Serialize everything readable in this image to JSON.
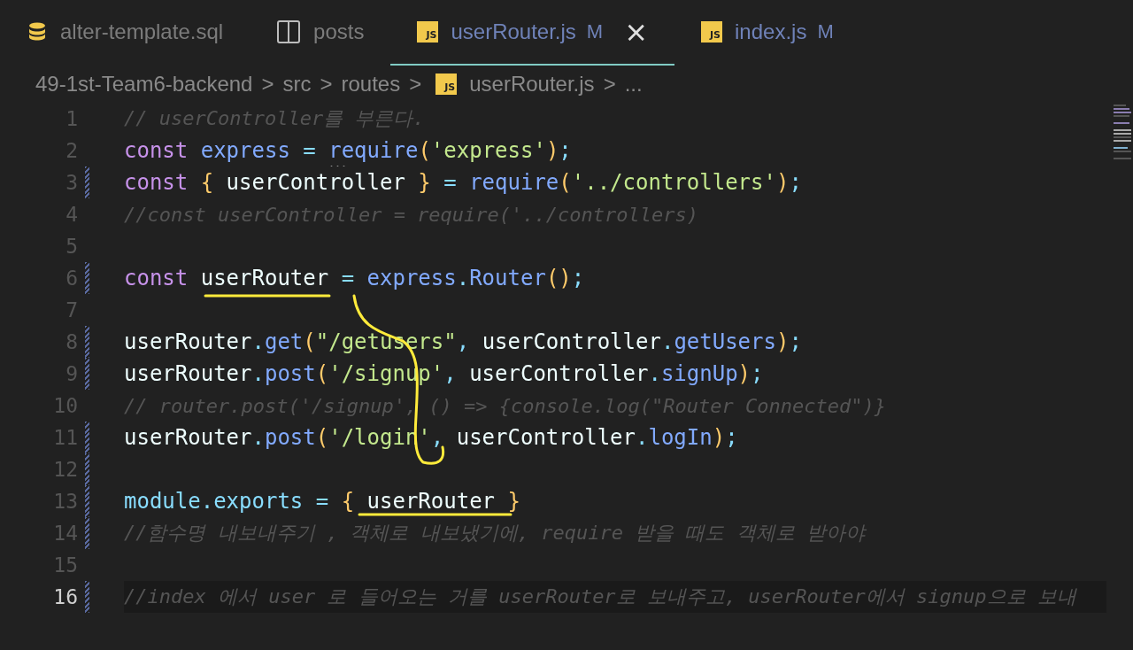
{
  "tabs": [
    {
      "kind": "database",
      "label": "alter-template.sql",
      "modified": false,
      "selected": false
    },
    {
      "kind": "split",
      "label": "posts",
      "modified": false,
      "selected": false
    },
    {
      "kind": "js",
      "icon_text": "JS",
      "label": "userRouter.js",
      "modified": true,
      "badge": "M",
      "selected": true,
      "close_glyph": "×"
    },
    {
      "kind": "js",
      "icon_text": "JS",
      "label": "index.js",
      "modified": true,
      "badge": "M",
      "selected": false
    }
  ],
  "breadcrumb": [
    {
      "label": "49-1st-Team6-backend"
    },
    {
      "label": "src"
    },
    {
      "label": "routes"
    },
    {
      "label": "userRouter.js",
      "kind": "js",
      "icon_text": "JS"
    },
    {
      "label": "..."
    }
  ],
  "breadcrumb_separator": ">",
  "lines": [
    {
      "number": "1",
      "changed": false,
      "current": false,
      "tokens": [
        {
          "kind": "comment",
          "s": "// userController를 부른다."
        }
      ]
    },
    {
      "number": "2",
      "changed": false,
      "current": false,
      "tokens": [
        {
          "kind": "keyword",
          "s": "const "
        },
        {
          "kind": "var",
          "s": "express"
        },
        {
          "kind": "op",
          "s": " = "
        },
        {
          "kind": "fn",
          "s": "require",
          "hint": true
        },
        {
          "kind": "bracket",
          "s": "("
        },
        {
          "kind": "string",
          "s": "'express'"
        },
        {
          "kind": "bracket",
          "s": ")"
        },
        {
          "kind": "op",
          "s": ";"
        }
      ]
    },
    {
      "number": "3",
      "changed": true,
      "current": false,
      "tokens": [
        {
          "kind": "keyword",
          "s": "const "
        },
        {
          "kind": "bracket",
          "s": "{"
        },
        {
          "kind": "plain",
          "s": " userController "
        },
        {
          "kind": "bracket",
          "s": "}"
        },
        {
          "kind": "op",
          "s": " = "
        },
        {
          "kind": "fn",
          "s": "require"
        },
        {
          "kind": "bracket",
          "s": "("
        },
        {
          "kind": "string",
          "s": "'../controllers'"
        },
        {
          "kind": "bracket",
          "s": ")"
        },
        {
          "kind": "op",
          "s": ";"
        }
      ]
    },
    {
      "number": "4",
      "changed": false,
      "current": false,
      "tokens": [
        {
          "kind": "comment",
          "s": "//const userController = require('../controllers)"
        }
      ]
    },
    {
      "number": "5",
      "changed": false,
      "current": false
    },
    {
      "number": "6",
      "changed": true,
      "current": false,
      "tokens": [
        {
          "kind": "keyword",
          "s": "const "
        },
        {
          "kind": "plain",
          "s": "userRouter"
        },
        {
          "kind": "op",
          "s": " = "
        },
        {
          "kind": "var",
          "s": "express"
        },
        {
          "kind": "op",
          "s": "."
        },
        {
          "kind": "fn",
          "s": "Router"
        },
        {
          "kind": "bracket",
          "s": "()"
        },
        {
          "kind": "op",
          "s": ";"
        }
      ]
    },
    {
      "number": "7",
      "changed": false,
      "current": false
    },
    {
      "number": "8",
      "changed": true,
      "current": false,
      "tokens": [
        {
          "kind": "plain",
          "s": "userRouter"
        },
        {
          "kind": "op",
          "s": "."
        },
        {
          "kind": "fn",
          "s": "get"
        },
        {
          "kind": "bracket",
          "s": "("
        },
        {
          "kind": "string",
          "s": "\"/getusers\""
        },
        {
          "kind": "op",
          "s": ", "
        },
        {
          "kind": "plain",
          "s": "userController"
        },
        {
          "kind": "op",
          "s": "."
        },
        {
          "kind": "fn",
          "s": "getUsers"
        },
        {
          "kind": "bracket",
          "s": ")"
        },
        {
          "kind": "op",
          "s": ";"
        }
      ]
    },
    {
      "number": "9",
      "changed": true,
      "current": false,
      "tokens": [
        {
          "kind": "plain",
          "s": "userRouter"
        },
        {
          "kind": "op",
          "s": "."
        },
        {
          "kind": "fn",
          "s": "post"
        },
        {
          "kind": "bracket",
          "s": "("
        },
        {
          "kind": "string",
          "s": "'/signup'"
        },
        {
          "kind": "op",
          "s": ", "
        },
        {
          "kind": "plain",
          "s": "userController"
        },
        {
          "kind": "op",
          "s": "."
        },
        {
          "kind": "fn",
          "s": "signUp"
        },
        {
          "kind": "bracket",
          "s": ")"
        },
        {
          "kind": "op",
          "s": ";"
        }
      ]
    },
    {
      "number": "10",
      "changed": false,
      "current": false,
      "tokens": [
        {
          "kind": "comment",
          "s": "// router.post('/signup', () => {console.log(\"Router Connected\")}"
        }
      ]
    },
    {
      "number": "11",
      "changed": true,
      "current": false,
      "tokens": [
        {
          "kind": "plain",
          "s": "userRouter"
        },
        {
          "kind": "op",
          "s": "."
        },
        {
          "kind": "fn",
          "s": "post"
        },
        {
          "kind": "bracket",
          "s": "("
        },
        {
          "kind": "string",
          "s": "'/login'"
        },
        {
          "kind": "op",
          "s": ", "
        },
        {
          "kind": "plain",
          "s": "userController"
        },
        {
          "kind": "op",
          "s": "."
        },
        {
          "kind": "fn",
          "s": "logIn"
        },
        {
          "kind": "bracket",
          "s": ")"
        },
        {
          "kind": "op",
          "s": ";"
        }
      ]
    },
    {
      "number": "12",
      "changed": true,
      "current": false
    },
    {
      "number": "13",
      "changed": true,
      "current": false,
      "tokens": [
        {
          "kind": "module",
          "s": "module"
        },
        {
          "kind": "op",
          "s": "."
        },
        {
          "kind": "module",
          "s": "exports"
        },
        {
          "kind": "op",
          "s": " = "
        },
        {
          "kind": "bracket",
          "s": "{"
        },
        {
          "kind": "plain",
          "s": " userRouter "
        },
        {
          "kind": "bracket",
          "s": "}"
        }
      ]
    },
    {
      "number": "14",
      "changed": true,
      "current": false,
      "tokens": [
        {
          "kind": "comment",
          "s": "//함수명 내보내주기 , 객체로 내보냈기에, require 받을 때도 객체로 받아야"
        }
      ]
    },
    {
      "number": "15",
      "changed": false,
      "current": false
    },
    {
      "number": "16",
      "changed": true,
      "current": true,
      "tokens": [
        {
          "kind": "comment",
          "s": "//index 에서 user 로 들어오는 거를 userRouter로 보내주고, userRouter에서 signup으로 보내"
        }
      ]
    }
  ]
}
